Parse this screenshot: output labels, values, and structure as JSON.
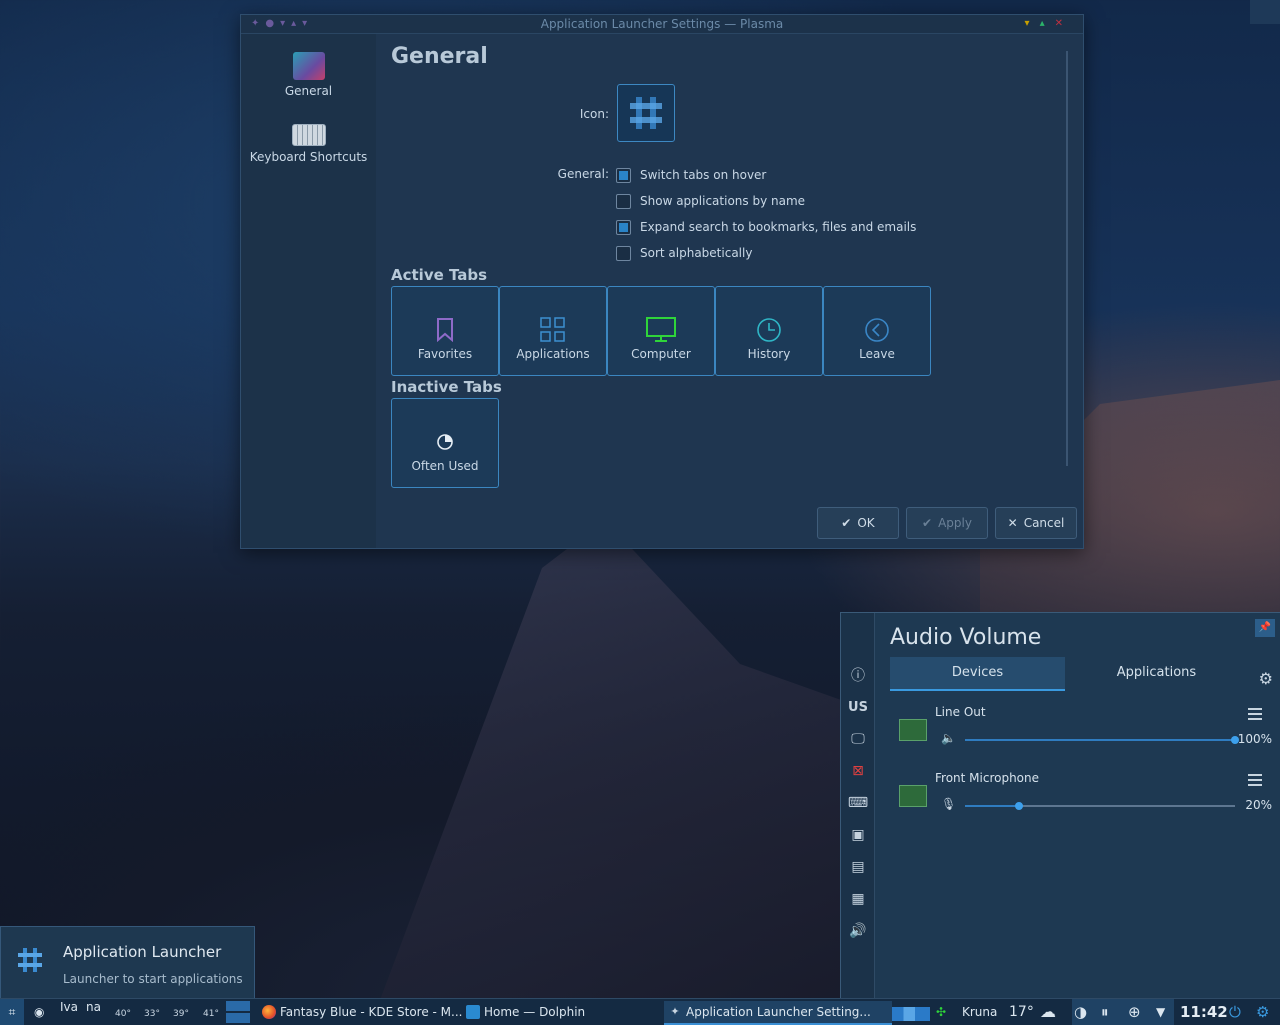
{
  "dialog": {
    "title": "Application Launcher Settings — Plasma",
    "sidebar": [
      {
        "label": "General",
        "icon": "launcher-settings-icon"
      },
      {
        "label": "Keyboard Shortcuts",
        "icon": "keyboard-icon"
      }
    ],
    "page_title": "General",
    "icon_label": "Icon:",
    "general_label": "General:",
    "options": [
      {
        "label": "Switch tabs on hover",
        "checked": true
      },
      {
        "label": "Show applications by name",
        "checked": false
      },
      {
        "label": "Expand search to bookmarks, files and emails",
        "checked": true
      },
      {
        "label": "Sort alphabetically",
        "checked": false
      }
    ],
    "active_tabs_title": "Active Tabs",
    "active_tabs": [
      {
        "label": "Favorites",
        "icon": "bookmark-icon"
      },
      {
        "label": "Applications",
        "icon": "grid-icon"
      },
      {
        "label": "Computer",
        "icon": "monitor-icon"
      },
      {
        "label": "History",
        "icon": "clock-icon"
      },
      {
        "label": "Leave",
        "icon": "leave-icon"
      }
    ],
    "inactive_tabs_title": "Inactive Tabs",
    "inactive_tabs": [
      {
        "label": "Often Used",
        "icon": "pie-icon"
      }
    ],
    "buttons": {
      "ok": "OK",
      "apply": "Apply",
      "cancel": "Cancel"
    }
  },
  "audio": {
    "title": "Audio Volume",
    "tabs": {
      "devices": "Devices",
      "applications": "Applications"
    },
    "devices": [
      {
        "name": "Line Out",
        "volume": 100,
        "volume_label": "100%"
      },
      {
        "name": "Front Microphone",
        "volume": 20,
        "volume_label": "20%"
      }
    ],
    "side_keyboard_layout": "US"
  },
  "tooltip": {
    "title": "Application Launcher",
    "subtitle": "Launcher to start applications"
  },
  "taskbar": {
    "widget_a": "Iva",
    "widget_b": "na",
    "temps": [
      "40°",
      "33°",
      "39°",
      "41°"
    ],
    "tasks": [
      {
        "label": "Fantasy Blue - KDE Store - M...",
        "icon": "firefox-icon"
      },
      {
        "label": "Home — Dolphin",
        "icon": "dolphin-icon"
      },
      {
        "label": "Application Launcher Setting...",
        "icon": "launcher-icon"
      }
    ],
    "weather_location": "Kruna",
    "weather_temp": "17°",
    "clock": "11:42"
  },
  "colors": {
    "accent": "#3a9ae0",
    "checkbox_on": "#2a84c8",
    "computer_icon": "#2fd43a"
  }
}
